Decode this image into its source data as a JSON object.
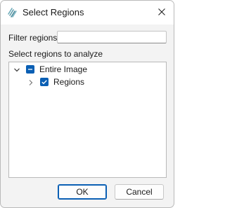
{
  "window": {
    "title": "Select Regions",
    "app_icon": "stacked-lines-logo-icon",
    "close_icon": "close-icon"
  },
  "filter": {
    "label": "Filter regions",
    "value": "",
    "placeholder": ""
  },
  "tree": {
    "section_label": "Select regions to analyze",
    "items": [
      {
        "label": "Entire Image",
        "expanded": true,
        "check_state": "indeterminate",
        "expander_icon": "chevron-down-icon"
      },
      {
        "label": "Regions",
        "expanded": false,
        "check_state": "checked",
        "expander_icon": "chevron-right-icon"
      }
    ]
  },
  "buttons": {
    "ok_label": "OK",
    "cancel_label": "Cancel"
  },
  "colors": {
    "accent": "#0a5fb4",
    "background": "#f3f3f3",
    "titlebar": "#ffffff"
  }
}
